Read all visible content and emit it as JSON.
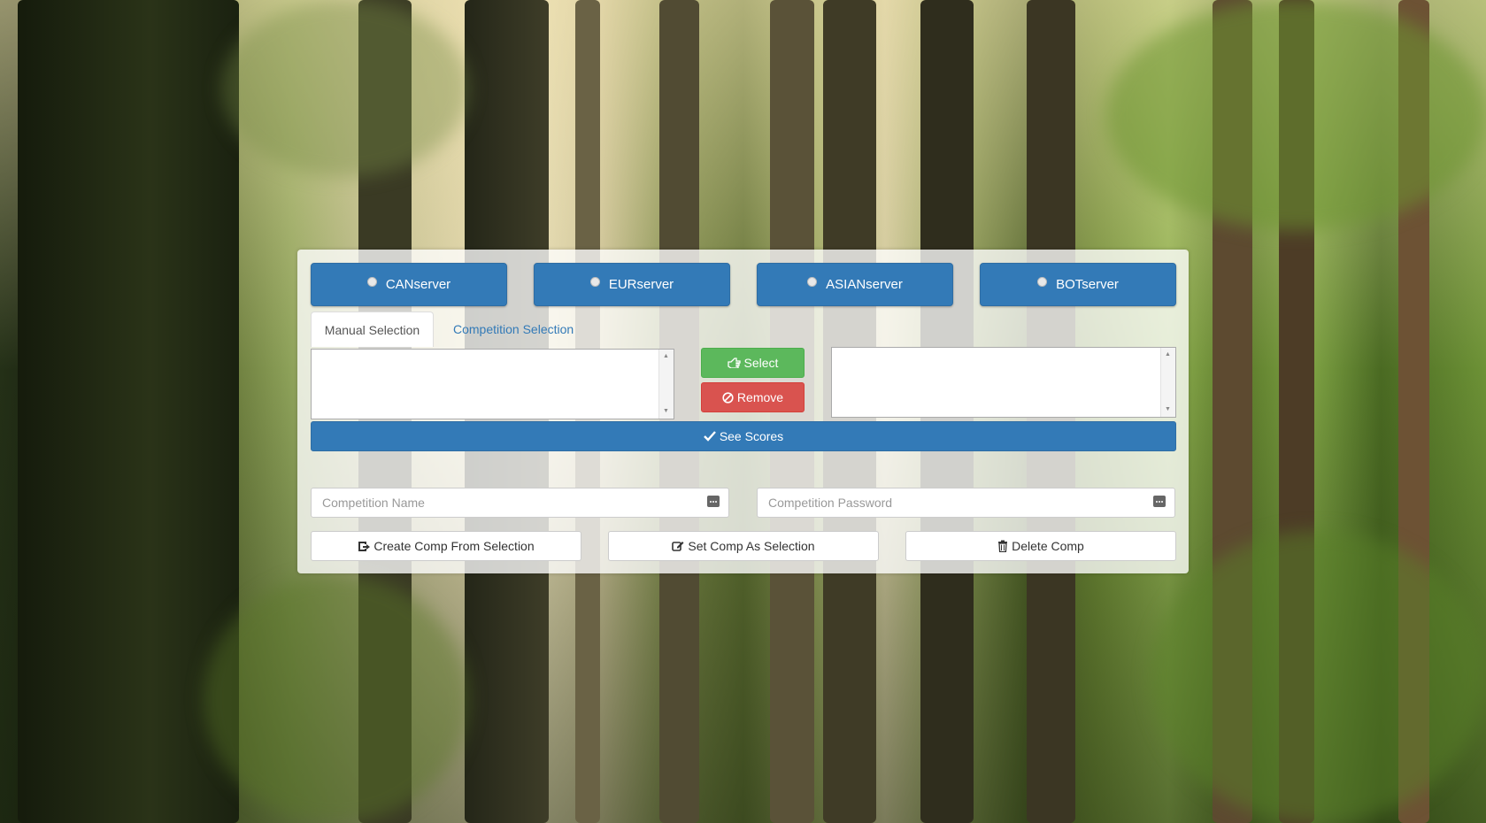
{
  "servers": [
    {
      "label": "CANserver"
    },
    {
      "label": "EURserver"
    },
    {
      "label": "ASIANserver"
    },
    {
      "label": "BOTserver"
    }
  ],
  "tabs": {
    "manual": "Manual Selection",
    "competition": "Competition Selection"
  },
  "buttons": {
    "select": "Select",
    "remove": "Remove",
    "see_scores": "See Scores",
    "create_comp": "Create Comp From Selection",
    "set_comp": "Set Comp As Selection",
    "delete_comp": "Delete Comp"
  },
  "fields": {
    "competition_name_placeholder": "Competition Name",
    "competition_password_placeholder": "Competition Password"
  },
  "colors": {
    "primary": "#337ab7",
    "success": "#5cb85c",
    "danger": "#d9534f"
  },
  "icons": {
    "server_radio": "radio-icon",
    "select": "hand-pointer-icon",
    "remove": "ban-icon",
    "see_scores": "check-icon",
    "create_comp": "share-icon",
    "set_comp": "edit-icon",
    "delete_comp": "trash-icon",
    "password_field": "key-dots-icon"
  }
}
